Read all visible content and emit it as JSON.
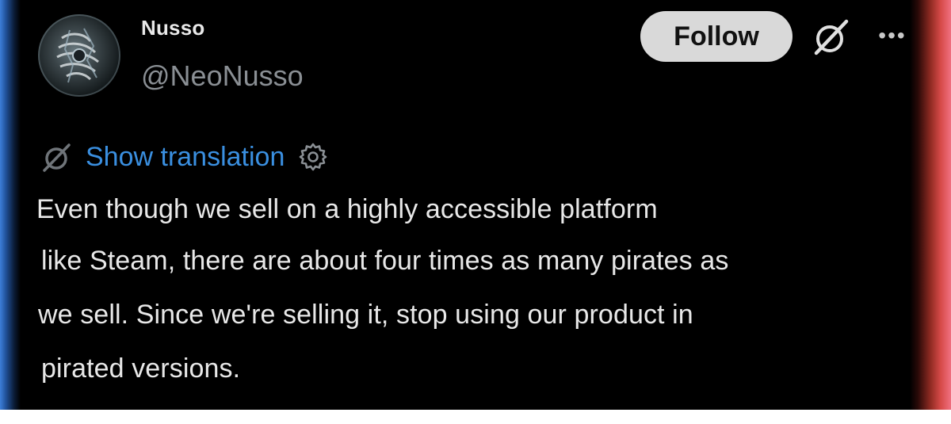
{
  "author": {
    "display_name": "Nusso",
    "handle": "@NeoNusso"
  },
  "actions": {
    "follow_label": "Follow",
    "more_label": "•••"
  },
  "icons": {
    "grok": "grok-icon",
    "translate": "translate-icon",
    "settings": "settings-gear-icon",
    "more": "more-options-icon"
  },
  "translation": {
    "link_label": "Show translation"
  },
  "post": {
    "lines": [
      "Even though we sell on a highly accessible platform",
      "like Steam, there are about four times as many pirates as",
      "we sell. Since we're selling it, stop using our product in",
      "pirated versions."
    ]
  },
  "colors": {
    "background": "#000000",
    "link": "#3a8fe0",
    "follow_bg": "#d9d9d9",
    "text": "#e8e8e8",
    "muted": "#8a8f94"
  }
}
